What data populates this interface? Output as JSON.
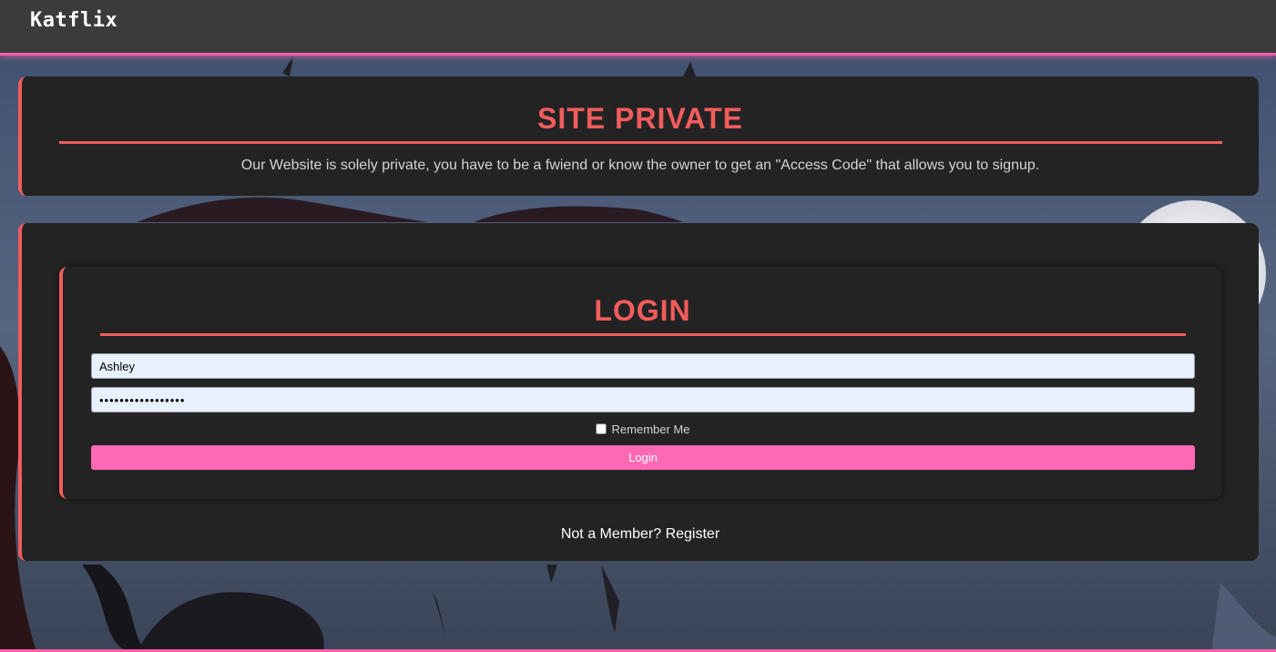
{
  "nav": {
    "brand": "Katflix"
  },
  "private_notice": {
    "title": "SITE PRIVATE",
    "message": "Our Website is solely private, you have to be a fwiend or know the owner to get an \"Access Code\" that allows you to signup."
  },
  "login": {
    "title": "LOGIN",
    "username_value": "Ashley",
    "password_value": "ashleyashley12345",
    "remember_label": "Remember Me",
    "remember_checked": false,
    "submit_label": "Login",
    "register_prompt": "Not a Member?",
    "register_link": "Register"
  },
  "colors": {
    "accent_red": "#f25c5c",
    "accent_pink": "#ff69b4",
    "card_bg": "#232323",
    "nav_bg": "#3b3b3b"
  }
}
